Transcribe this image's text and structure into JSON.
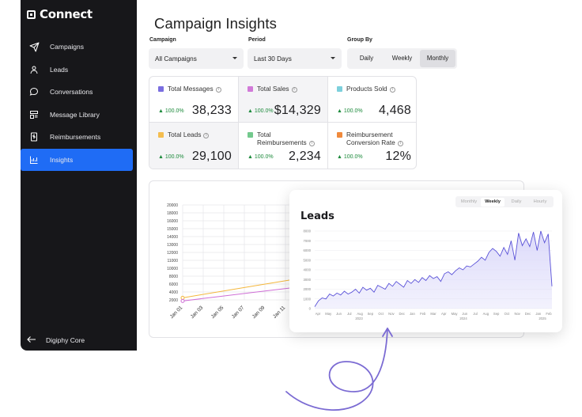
{
  "brand": {
    "name": "Connect"
  },
  "sidebar": {
    "items": [
      {
        "label": "Campaigns",
        "icon": "send-icon"
      },
      {
        "label": "Leads",
        "icon": "user-icon"
      },
      {
        "label": "Conversations",
        "icon": "chat-bubble-icon"
      },
      {
        "label": "Message Library",
        "icon": "library-icon"
      },
      {
        "label": "Reimbursements",
        "icon": "receipt-dollar-icon"
      },
      {
        "label": "Insights",
        "icon": "bar-chart-icon",
        "active": true
      }
    ],
    "footer": {
      "label": "Digiphy Core",
      "icon": "arrow-left-icon"
    },
    "active_color": "#1f6cf5"
  },
  "page": {
    "title": "Campaign Insights"
  },
  "filters": {
    "campaign": {
      "label": "Campaign",
      "value": "All Campaigns"
    },
    "period": {
      "label": "Period",
      "value": "Last 30 Days"
    },
    "group_by": {
      "label": "Group By",
      "options": [
        "Daily",
        "Weekly",
        "Monthly"
      ],
      "selected": "Monthly"
    }
  },
  "stats": [
    {
      "label": "Total Messages",
      "change": "▲ 100.0%",
      "value": "38,233",
      "color": "#7a6ee0"
    },
    {
      "label": "Total Sales",
      "change": "▲ 100.0%",
      "value": "$14,329",
      "color": "#d17ad8"
    },
    {
      "label": "Products Sold",
      "change": "▲ 100.0%",
      "value": "4,468",
      "color": "#7dd0dc"
    },
    {
      "label": "Total Leads",
      "change": "▲ 100.0%",
      "value": "29,100",
      "color": "#f4bd4f"
    },
    {
      "label_lines": [
        "Total",
        "Reimbursements"
      ],
      "change": "▲ 100.0%",
      "value": "2,234",
      "color": "#73c98d"
    },
    {
      "label_lines": [
        "Reimbursement",
        "Conversion Rate"
      ],
      "change": "▲ 100.0%",
      "value": "12%",
      "color": "#f08a3c"
    }
  ],
  "chart_data": [
    {
      "type": "line",
      "title": "",
      "y_ticks": [
        "20000",
        "18000",
        "16000",
        "15000",
        "14000",
        "13000",
        "12000",
        "11000",
        "10000",
        "8000",
        "6000",
        "4000",
        "2000"
      ],
      "categories": [
        "Jan 01",
        "Jan 03",
        "Jan 05",
        "Jan 07",
        "Jan 09",
        "Jan 11"
      ],
      "series": [
        {
          "color": "#f4b73d",
          "values": [
            2400,
            3500,
            4600,
            5700,
            6800,
            7900
          ]
        },
        {
          "color": "#cf6fd6",
          "values": [
            1800,
            2600,
            3400,
            4200,
            5000,
            5800
          ]
        }
      ],
      "ylim": [
        2000,
        20000
      ],
      "grid": true
    },
    {
      "type": "area",
      "title": "Leads",
      "tabs": [
        "Monthly",
        "Weekly",
        "Daily",
        "Hourly"
      ],
      "selected_tab": "Weekly",
      "y_ticks": [
        0,
        1000,
        2000,
        3000,
        4000,
        5000,
        6000,
        7000,
        8000
      ],
      "ylim": [
        0,
        8000
      ],
      "x_labels": [
        "Apr",
        "May",
        "Jun",
        "Jul",
        "Aug",
        "Sep",
        "Oct",
        "Nov",
        "Dec",
        "Jan",
        "Feb",
        "Mar",
        "Apr",
        "May",
        "Jun",
        "Jul",
        "Aug",
        "Sep",
        "Oct",
        "Nov",
        "Dec",
        "Jan",
        "Feb"
      ],
      "year_labels": [
        "2023",
        "2024",
        "2025"
      ],
      "values": [
        200,
        800,
        1100,
        1000,
        1500,
        1300,
        1600,
        1400,
        1800,
        1500,
        1700,
        2000,
        1600,
        2200,
        1900,
        2100,
        1700,
        2400,
        2200,
        2000,
        2600,
        2300,
        2800,
        2500,
        2200,
        2900,
        2600,
        3000,
        2700,
        3200,
        2900,
        3400,
        3100,
        3300,
        2800,
        3600,
        3800,
        3500,
        3900,
        4200,
        4000,
        4400,
        4300,
        4600,
        4900,
        5300,
        5000,
        5800,
        6200,
        5900,
        5400,
        6300,
        5600,
        7000,
        5000,
        7800,
        6500,
        7200,
        6400,
        7900,
        6000,
        8000,
        6800,
        7700,
        2300
      ],
      "color": "#5a52d8",
      "fill": "#dcdafa",
      "grid": true
    }
  ],
  "annotation": {
    "arrow_color": "#7b6bd3"
  }
}
